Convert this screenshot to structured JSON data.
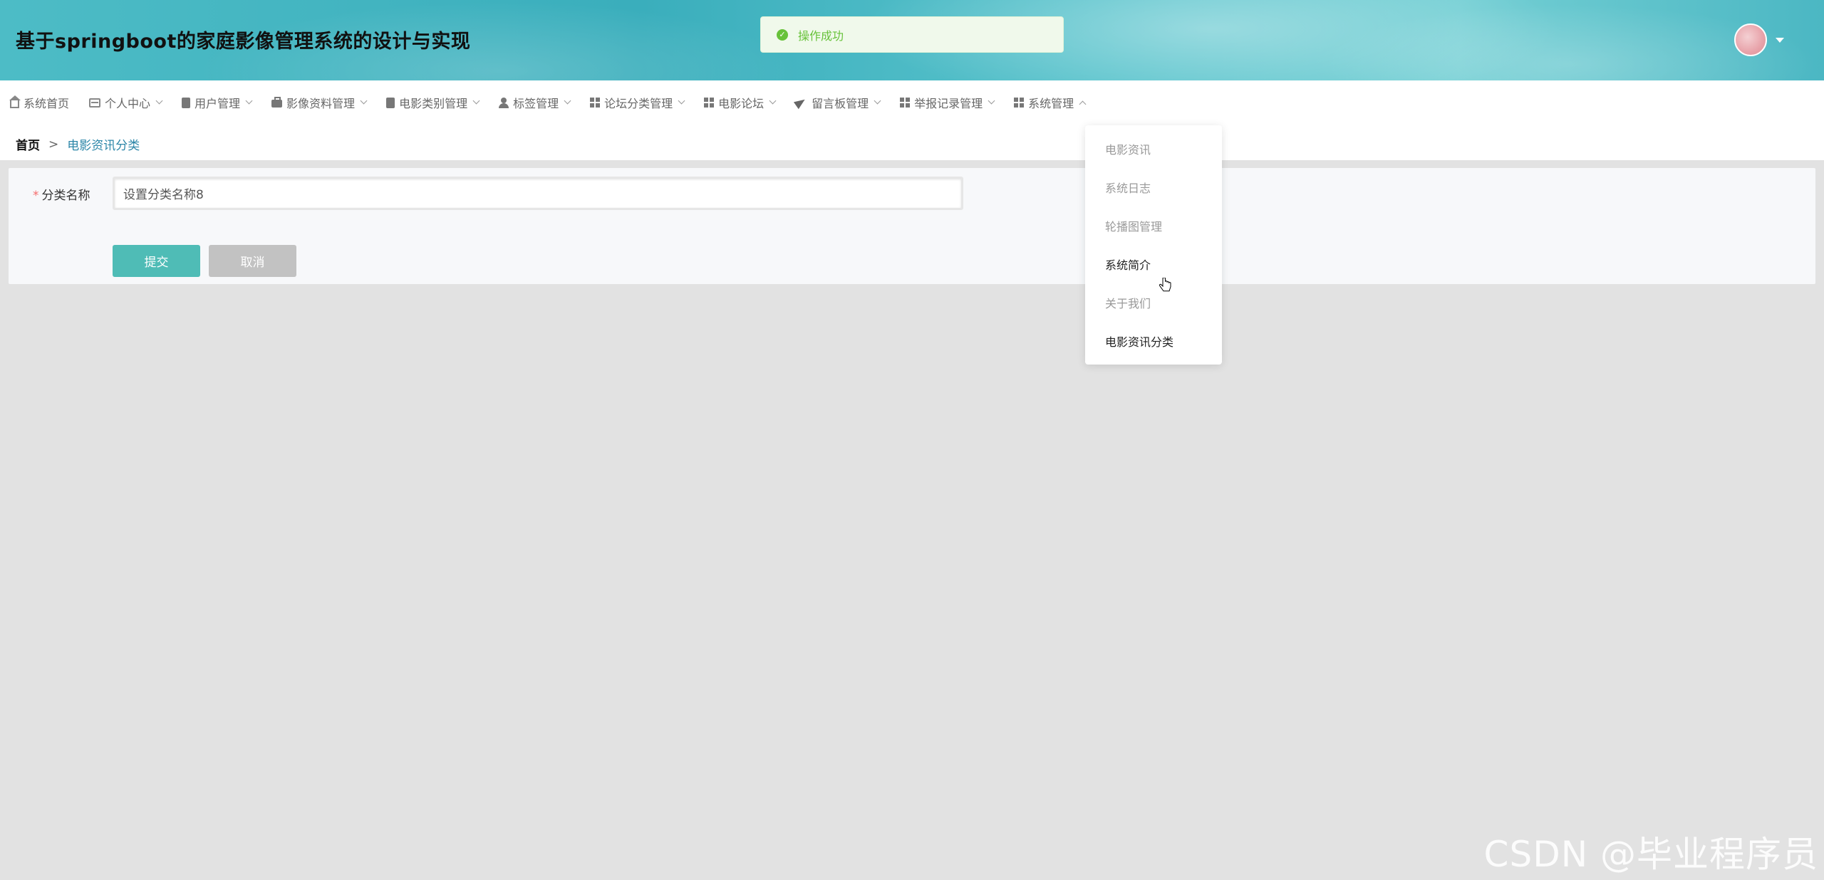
{
  "header": {
    "title": "基于springboot的家庭影像管理系统的设计与实现"
  },
  "toast": {
    "message": "操作成功"
  },
  "nav": {
    "items": [
      {
        "label": "系统首页"
      },
      {
        "label": "个人中心"
      },
      {
        "label": "用户管理"
      },
      {
        "label": "影像资料管理"
      },
      {
        "label": "电影类别管理"
      },
      {
        "label": "标签管理"
      },
      {
        "label": "论坛分类管理"
      },
      {
        "label": "电影论坛"
      },
      {
        "label": "留言板管理"
      },
      {
        "label": "举报记录管理"
      },
      {
        "label": "系统管理"
      }
    ]
  },
  "breadcrumb": {
    "home": "首页",
    "separator": ">",
    "current": "电影资讯分类"
  },
  "form": {
    "required_mark": "*",
    "label": "分类名称",
    "value": "设置分类名称8",
    "submit_label": "提交",
    "cancel_label": "取消"
  },
  "dropdown": {
    "items": [
      {
        "label": "电影资讯"
      },
      {
        "label": "系统日志"
      },
      {
        "label": "轮播图管理"
      },
      {
        "label": "系统简介"
      },
      {
        "label": "关于我们"
      },
      {
        "label": "电影资讯分类"
      }
    ]
  },
  "watermark": "CSDN @毕业程序员",
  "colors": {
    "primary": "#4fbcb6",
    "link": "#2c86a8",
    "success": "#67c23a",
    "required": "#f56c6c"
  }
}
